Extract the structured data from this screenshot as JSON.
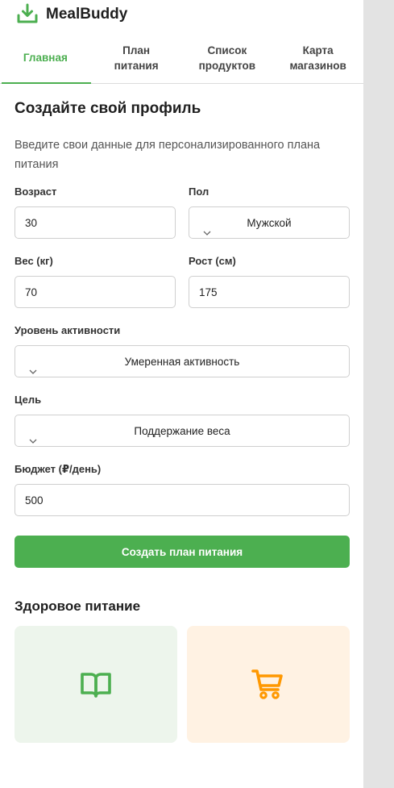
{
  "app": {
    "name": "MealBuddy"
  },
  "tabs": [
    {
      "line1": "Главная",
      "line2": ""
    },
    {
      "line1": "План",
      "line2": "питания"
    },
    {
      "line1": "Список",
      "line2": "продуктов"
    },
    {
      "line1": "Карта",
      "line2": "магазинов"
    }
  ],
  "profile": {
    "title": "Создайте свой профиль",
    "subtitle": "Введите свои данные для персонализированного плана питания",
    "age": {
      "label": "Возраст",
      "value": "30"
    },
    "gender": {
      "label": "Пол",
      "value": "Мужской"
    },
    "weight": {
      "label": "Вес (кг)",
      "value": "70"
    },
    "height": {
      "label": "Рост (см)",
      "value": "175"
    },
    "activity": {
      "label": "Уровень активности",
      "value": "Умеренная активность"
    },
    "goal": {
      "label": "Цель",
      "value": "Поддержание веса"
    },
    "budget": {
      "label": "Бюджет (₽/день)",
      "value": "500"
    },
    "submit_label": "Создать план питания"
  },
  "healthy": {
    "title": "Здоровое питание",
    "cards": [
      {
        "icon": "book-icon",
        "color": "#4caf50"
      },
      {
        "icon": "cart-icon",
        "color": "#ff9800"
      }
    ]
  },
  "colors": {
    "accent": "#4caf50",
    "orange": "#ff9800",
    "card_green_bg": "#edf5ec",
    "card_orange_bg": "#fff2e3"
  }
}
